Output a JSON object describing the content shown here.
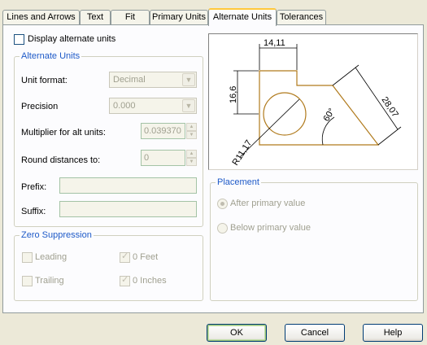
{
  "tabs": [
    {
      "label": "Lines and Arrows"
    },
    {
      "label": "Text"
    },
    {
      "label": "Fit"
    },
    {
      "label": "Primary Units"
    },
    {
      "label": "Alternate Units"
    },
    {
      "label": "Tolerances"
    }
  ],
  "display_alt_units": {
    "label": "Display alternate units",
    "checked": false
  },
  "alternate_units": {
    "title": "Alternate Units",
    "unit_format": {
      "label": "Unit format:",
      "value": "Decimal"
    },
    "precision": {
      "label": "Precision",
      "value": "0.000"
    },
    "multiplier": {
      "label": "Multiplier for alt units:",
      "value": "0.039370"
    },
    "round": {
      "label": "Round distances  to:",
      "value": "0"
    },
    "prefix": {
      "label": "Prefix:",
      "value": ""
    },
    "suffix": {
      "label": "Suffix:",
      "value": ""
    }
  },
  "zero_suppression": {
    "title": "Zero Suppression",
    "leading": {
      "label": "Leading",
      "checked": false
    },
    "trailing": {
      "label": "Trailing",
      "checked": false
    },
    "feet": {
      "label": "0 Feet",
      "checked": true
    },
    "inches": {
      "label": "0 Inches",
      "checked": true
    }
  },
  "preview": {
    "dim_top": "14,11",
    "dim_left": "16,6",
    "dim_right": "28,07",
    "dim_angle": "60°",
    "dim_radius": "R11,17",
    "line_color": "#b07a1c",
    "dim_color": "#000000"
  },
  "placement": {
    "title": "Placement",
    "after": {
      "label": "After primary value",
      "selected": true
    },
    "below": {
      "label": "Below primary value",
      "selected": false
    }
  },
  "buttons": {
    "ok": "OK",
    "cancel": "Cancel",
    "help": "Help"
  },
  "colors": {
    "accent_tab": "#ffc83c",
    "group_title": "#1e5ac8",
    "disabled_text": "#a0a090"
  }
}
